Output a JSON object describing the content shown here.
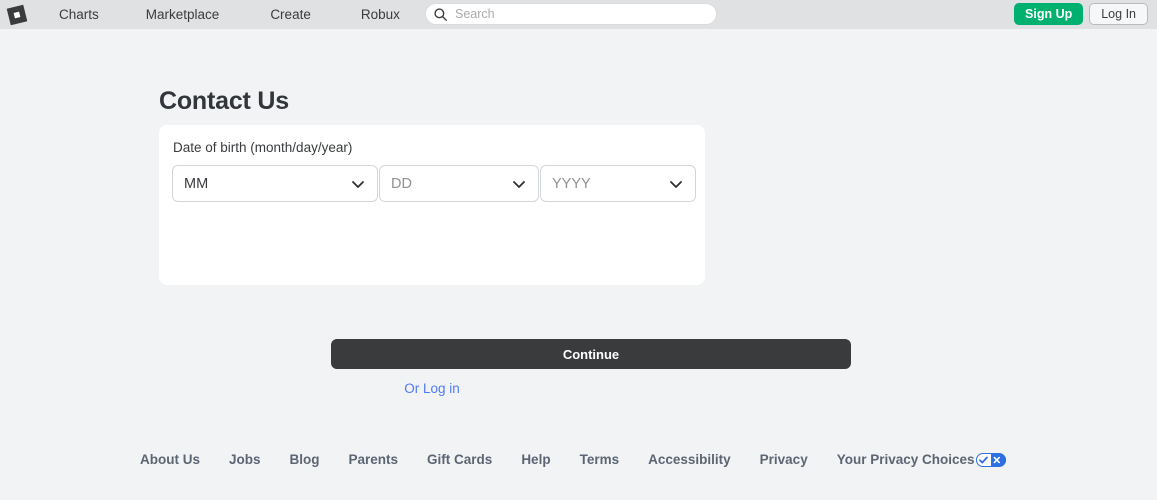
{
  "header": {
    "logo_icon": "roblox-logo-icon",
    "nav": [
      {
        "label": "Charts"
      },
      {
        "label": "Marketplace"
      },
      {
        "label": "Create"
      },
      {
        "label": "Robux"
      }
    ],
    "search": {
      "icon": "search-icon",
      "placeholder": "Search",
      "value": ""
    },
    "sign_up_label": "Sign Up",
    "log_in_label": "Log In",
    "colors": {
      "bar_background": "#dfe1e3",
      "sign_up_green": "#00b06f"
    }
  },
  "main": {
    "page_title": "Contact Us",
    "card": {
      "dob_label": "Date of birth (month/day/year)",
      "month_value": "MM",
      "day_value": "DD",
      "year_value": "YYYY",
      "chevron_icon": "chevron-down-icon",
      "continue_label": "Continue",
      "login_link_label": "Or Log in",
      "colors": {
        "continue_button": "#393b3d",
        "link_blue": "#4f7af5"
      }
    }
  },
  "footer": {
    "links": [
      {
        "label": "About Us"
      },
      {
        "label": "Jobs"
      },
      {
        "label": "Blog"
      },
      {
        "label": "Parents"
      },
      {
        "label": "Gift Cards"
      },
      {
        "label": "Help"
      },
      {
        "label": "Terms"
      },
      {
        "label": "Accessibility"
      },
      {
        "label": "Privacy"
      }
    ],
    "privacy_choices": {
      "label": "Your Privacy Choices",
      "icon": "privacy-choices-toggle-icon"
    },
    "link_color": "#5b6573"
  }
}
